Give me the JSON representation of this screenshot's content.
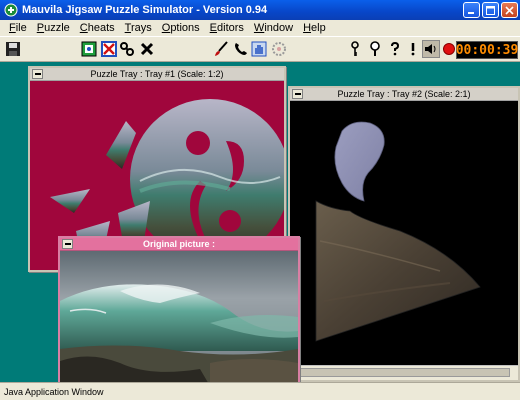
{
  "window": {
    "title": "Mauvila Jigsaw Puzzle Simulator - Version 0.94"
  },
  "menu": [
    {
      "label": "File",
      "accel": "F"
    },
    {
      "label": "Puzzle",
      "accel": "P"
    },
    {
      "label": "Cheats",
      "accel": "C"
    },
    {
      "label": "Trays",
      "accel": "T"
    },
    {
      "label": "Options",
      "accel": "O"
    },
    {
      "label": "Editors",
      "accel": "E"
    },
    {
      "label": "Window",
      "accel": "W"
    },
    {
      "label": "Help",
      "accel": "H"
    }
  ],
  "toolbar": {
    "icons": [
      "save-icon",
      "shuffle-icon",
      "clear-icon",
      "link-icon",
      "scatter-icon",
      "brush-icon",
      "phone-icon",
      "hand-icon",
      "gear-icon",
      "key-icon",
      "magnifier-icon",
      "question-icon",
      "exclamation-icon",
      "sound-icon",
      "record-icon"
    ],
    "timer": "00:00:39"
  },
  "tray1": {
    "title": "Puzzle Tray : Tray #1   (Scale: 1:2)",
    "bg": "#A0063C"
  },
  "tray2": {
    "title": "Puzzle Tray : Tray #2   (Scale: 2:1)"
  },
  "original": {
    "title": "Original picture :"
  },
  "status": {
    "text": "Java Application Window"
  }
}
